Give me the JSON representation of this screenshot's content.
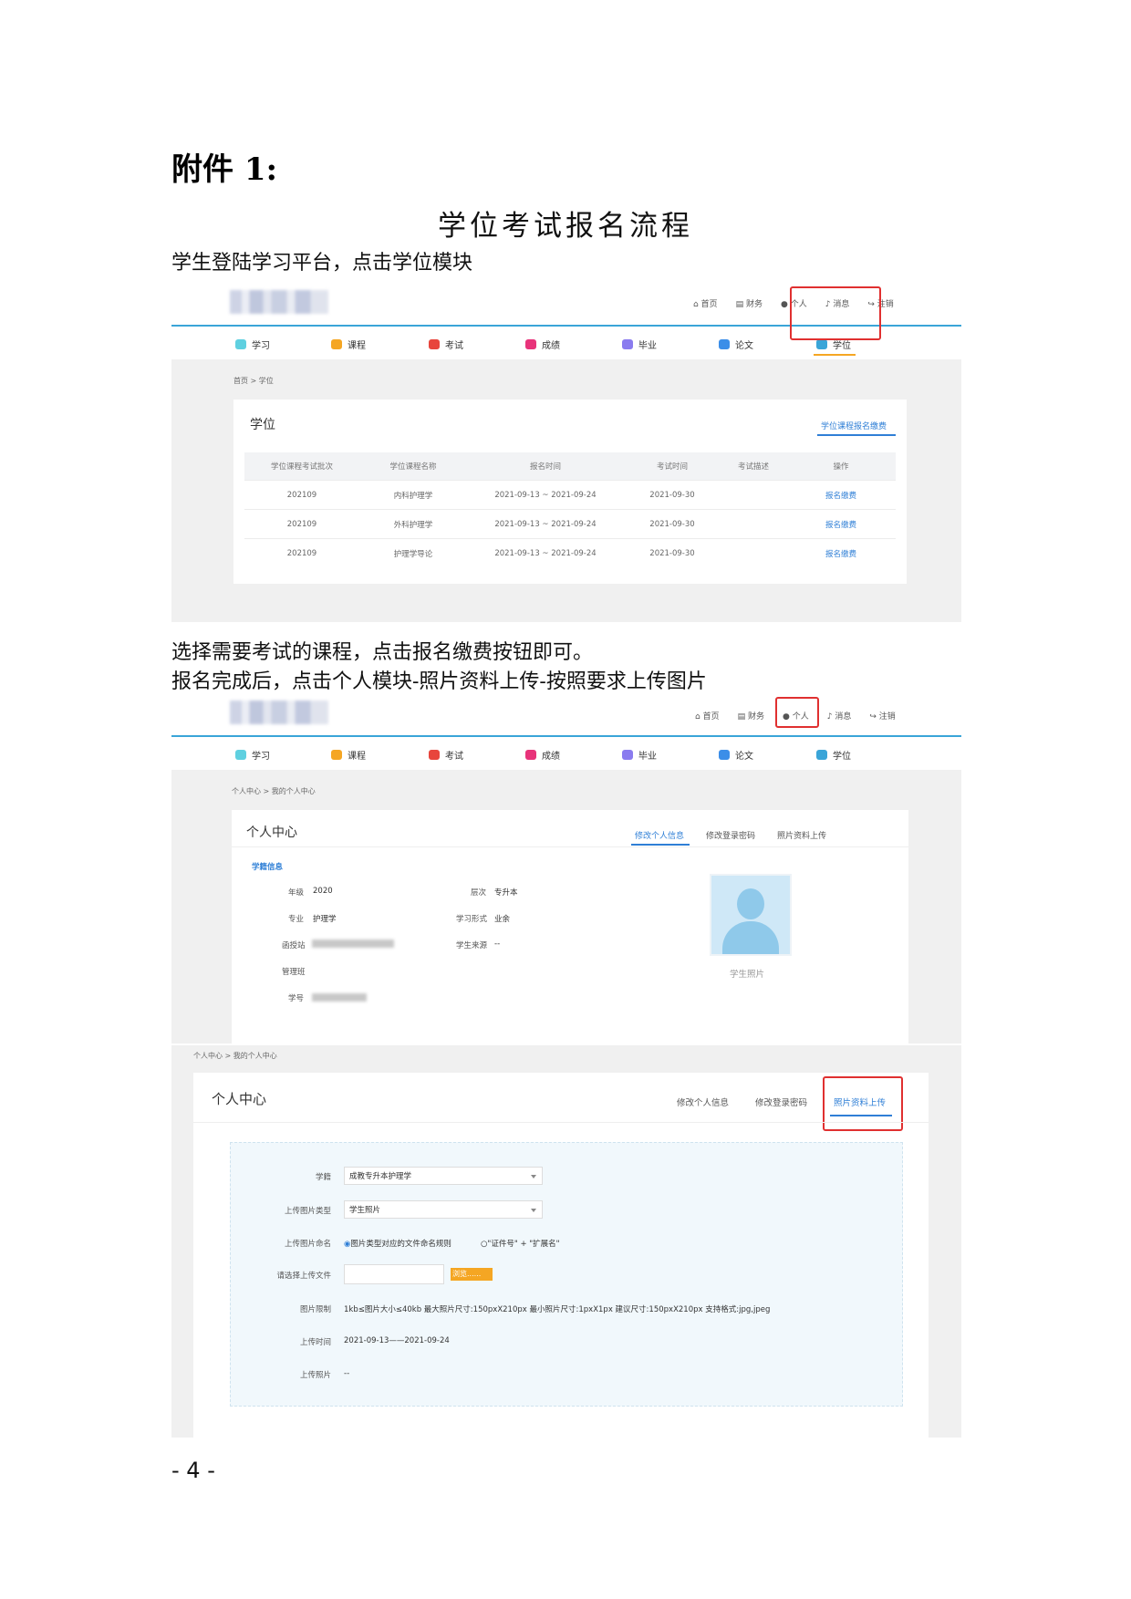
{
  "heading": "附件 1:",
  "title": "学位考试报名流程",
  "step1": "学生登陆学习平台，点击学位模块",
  "step2": "选择需要考试的课程，点击报名缴费按钮即可。",
  "step3": "报名完成后，点击个人模块-照片资料上传-按照要求上传图片",
  "page_number": "- 4 -",
  "toplinks": [
    "首页",
    "财务",
    "个人",
    "消息",
    "注销"
  ],
  "nav": [
    "学习",
    "课程",
    "考试",
    "成绩",
    "毕业",
    "论文",
    "学位"
  ],
  "nav_colors": [
    "#5fd0e0",
    "#f5a623",
    "#e8453c",
    "#e8337a",
    "#8a7bef",
    "#3b8ee8",
    "#3aa5d8"
  ],
  "shot1": {
    "breadcrumb": "首页 > 学位",
    "card_title": "学位",
    "tab": "学位课程报名缴费",
    "columns": [
      "学位课程考试批次",
      "学位课程名称",
      "报名时间",
      "考试时间",
      "考试描述",
      "操作"
    ],
    "rows": [
      [
        "202109",
        "内科护理学",
        "2021-09-13 ~ 2021-09-24",
        "2021-09-30",
        "",
        "报名缴费"
      ],
      [
        "202109",
        "外科护理学",
        "2021-09-13 ~ 2021-09-24",
        "2021-09-30",
        "",
        "报名缴费"
      ],
      [
        "202109",
        "护理学导论",
        "2021-09-13 ~ 2021-09-24",
        "2021-09-30",
        "",
        "报名缴费"
      ]
    ]
  },
  "shot2": {
    "breadcrumb": "个人中心 > 我的个人中心",
    "card_title": "个人中心",
    "tabs": [
      "修改个人信息",
      "修改登录密码",
      "照片资料上传"
    ],
    "section": "学籍信息",
    "grade_label": "年级",
    "grade_value": "2020",
    "level_label": "层次",
    "level_value": "专升本",
    "major_label": "专业",
    "major_value": "护理学",
    "mode_label": "学习形式",
    "mode_value": "业余",
    "station_label": "函授站",
    "source_label": "学生来源",
    "source_value": "--",
    "class_label": "管理班",
    "id_label": "学号",
    "photo_caption": "学生照片"
  },
  "shot3": {
    "breadcrumb": "个人中心 > 我的个人中心",
    "card_title": "个人中心",
    "tabs": [
      "修改个人信息",
      "修改登录密码",
      "照片资料上传"
    ],
    "xueji_label": "学籍",
    "xueji_value": "成教专升本护理学",
    "type_label": "上传图片类型",
    "type_value": "学生照片",
    "naming_label": "上传图片命名",
    "naming_opt1": "图片类型对应的文件命名规则",
    "naming_opt2": "\"证件号\" + \"扩展名\"",
    "file_label": "请选择上传文件",
    "browse": "浏览......",
    "limit_label": "图片限制",
    "limit_value": "1kb≤图片大小≤40kb 最大照片尺寸:150pxX210px 最小照片尺寸:1pxX1px 建议尺寸:150pxX210px 支持格式:jpg,jpeg",
    "time_label": "上传时间",
    "time_value": "2021-09-13——2021-09-24",
    "photo_label": "上传照片",
    "photo_value": "--"
  }
}
